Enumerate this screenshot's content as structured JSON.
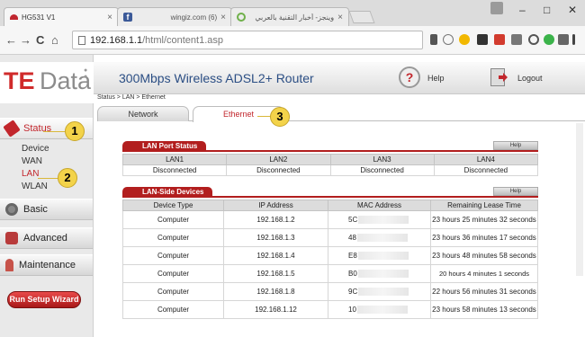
{
  "browser": {
    "tabs": [
      {
        "title": "HG531 V1",
        "close": "×"
      },
      {
        "title": "wingiz.com (6)",
        "close": "×"
      },
      {
        "title": "وينجز- أخبار التقنية بالعربي",
        "close": "×"
      }
    ],
    "window_controls": {
      "minimize": "–",
      "maximize": "□",
      "close": "✕"
    },
    "nav": {
      "back": "←",
      "forward": "→",
      "reload": "C",
      "home": "⌂"
    },
    "address": {
      "host": "192.168.1.1",
      "path": "/html/content1.asp"
    }
  },
  "router": {
    "logo": {
      "brand_red": "TE",
      "brand_grey": "Data"
    },
    "header_title": "300Mbps Wireless ADSL2+ Router",
    "help_label": "Help",
    "logout_label": "Logout",
    "sidebar": {
      "status_label": "Status",
      "submenu": [
        "Device",
        "WAN",
        "LAN",
        "WLAN"
      ],
      "basic_label": "Basic",
      "advanced_label": "Advanced",
      "maintenance_label": "Maintenance",
      "wizard_label": "Run Setup Wizard"
    },
    "breadcrumb": "Status > LAN > Ethernet",
    "tabs": {
      "network": "Network",
      "ethernet": "Ethernet"
    },
    "port_status": {
      "title": "LAN Port Status",
      "help": "Help",
      "headers": [
        "LAN1",
        "LAN2",
        "LAN3",
        "LAN4"
      ],
      "values": [
        "Disconnected",
        "Disconnected",
        "Disconnected",
        "Disconnected"
      ]
    },
    "devices": {
      "title": "LAN-Side Devices",
      "help": "Help",
      "headers": [
        "Device Type",
        "IP Address",
        "MAC Address",
        "Remaining Lease Time"
      ],
      "rows": [
        {
          "type": "Computer",
          "ip": "192.168.1.2",
          "mac": "5C",
          "lease": "23 hours 25 minutes 32 seconds"
        },
        {
          "type": "Computer",
          "ip": "192.168.1.3",
          "mac": "48",
          "lease": "23 hours 36 minutes 17 seconds"
        },
        {
          "type": "Computer",
          "ip": "192.168.1.4",
          "mac": "E8",
          "lease": "23 hours 48 minutes 58 seconds"
        },
        {
          "type": "Computer",
          "ip": "192.168.1.5",
          "mac": "B0",
          "lease": "20 hours 4 minutes 1 seconds"
        },
        {
          "type": "Computer",
          "ip": "192.168.1.8",
          "mac": "9C",
          "lease": "22 hours 56 minutes 31 seconds"
        },
        {
          "type": "Computer",
          "ip": "192.168.1.12",
          "mac": "10",
          "lease": "23 hours 58 minutes 13 seconds"
        }
      ]
    },
    "callouts": [
      "1",
      "2",
      "3"
    ]
  },
  "colors": {
    "accent_red": "#c2262c",
    "title_blue": "#2b4e84",
    "callout_yellow": "#f3d34a"
  }
}
